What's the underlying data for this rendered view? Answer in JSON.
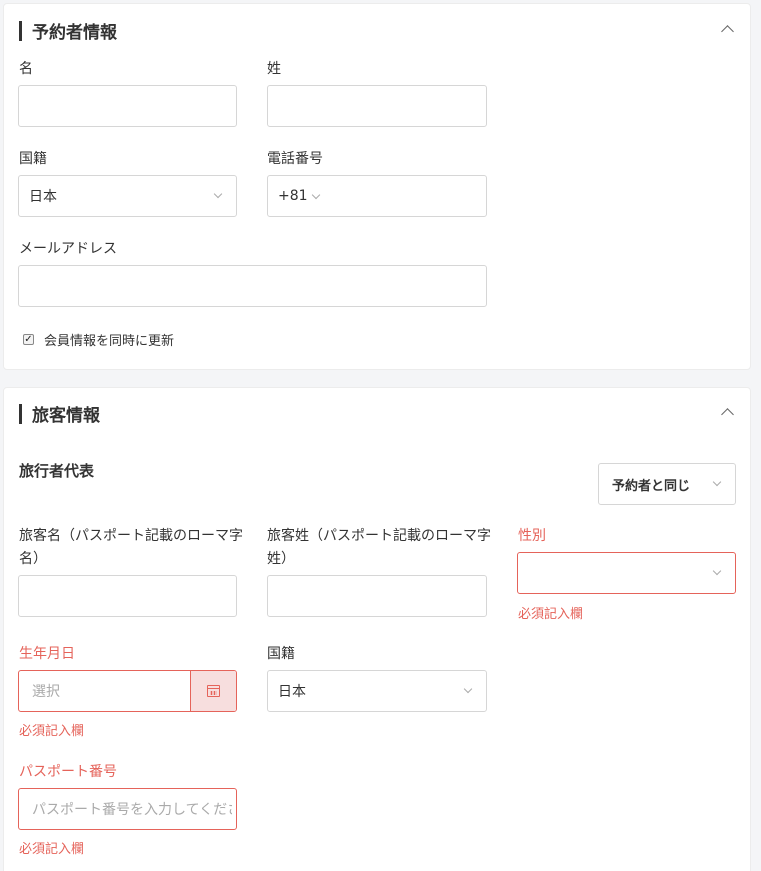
{
  "booker": {
    "title": "予約者情報",
    "first_name_label": "名",
    "first_name_value": "",
    "last_name_label": "姓",
    "last_name_value": "",
    "nationality_label": "国籍",
    "nationality_value": "日本",
    "phone_label": "電話番号",
    "phone_code": "+81",
    "phone_value": "",
    "email_label": "メールアドレス",
    "email_value": "",
    "update_member_label": "会員情報を同時に更新",
    "update_member_checked": true
  },
  "traveler": {
    "title": "旅客情報",
    "rep_label": "旅行者代表",
    "same_as_booker": "予約者と同じ",
    "given_name_label": "旅客名（パスポート記載のローマ字名）",
    "given_name_value": "",
    "surname_label": "旅客姓（パスポート記載のローマ字姓）",
    "surname_value": "",
    "gender_label": "性別",
    "gender_value": "",
    "gender_error": "必須記入欄",
    "birth_label": "生年月日",
    "birth_placeholder": "選択",
    "birth_error": "必須記入欄",
    "nationality_label": "国籍",
    "nationality_value": "日本",
    "passport_label": "パスポート番号",
    "passport_placeholder": "パスポート番号を入力してください",
    "passport_error": "必須記入欄"
  },
  "colors": {
    "error": "#e5635a",
    "border": "#d6d6d6",
    "text": "#333333"
  },
  "icons": {
    "collapse": "chevron-up-icon",
    "dropdown": "chevron-down-icon",
    "calendar": "calendar-icon",
    "checkbox": "checkbox-icon"
  }
}
